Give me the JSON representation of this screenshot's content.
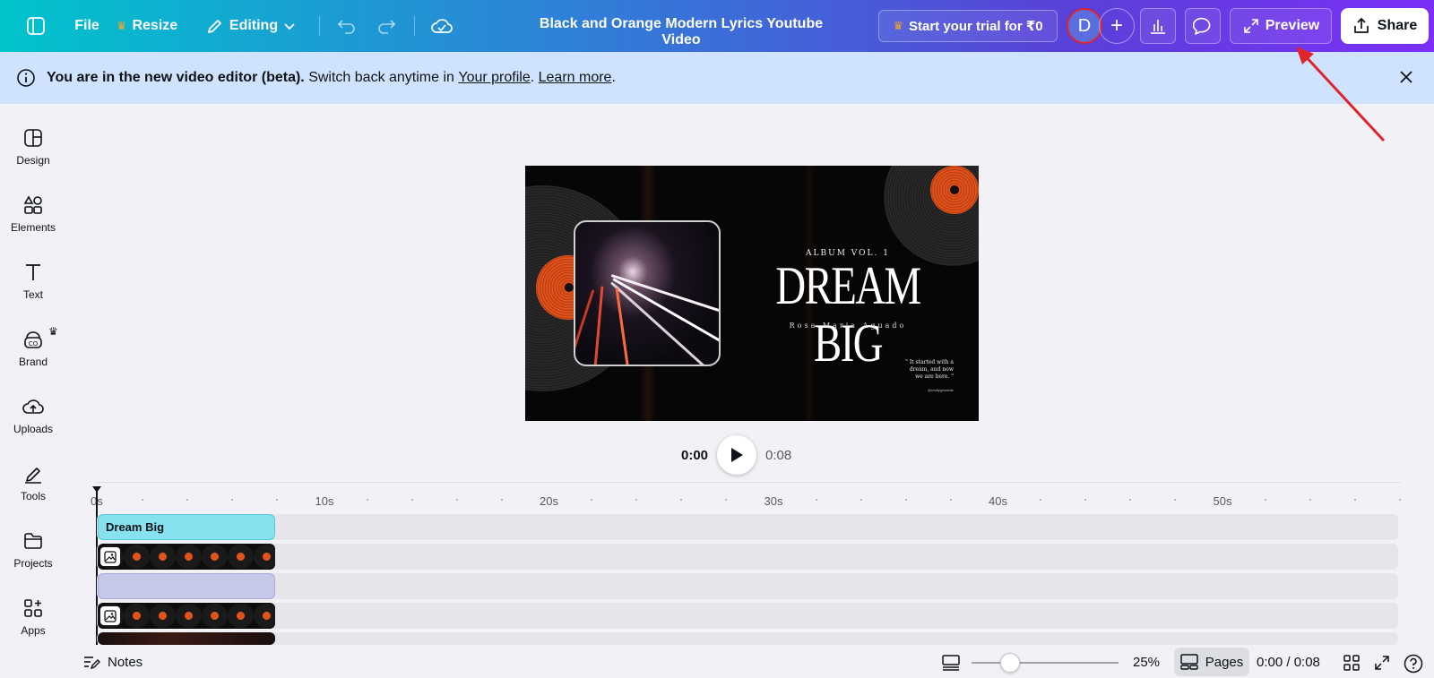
{
  "topbar": {
    "file_label": "File",
    "resize_label": "Resize",
    "editing_label": "Editing",
    "title": "Black and Orange Modern Lyrics Youtube Video",
    "trial_label": "Start your trial for ₹0",
    "avatar_initial": "D",
    "preview_label": "Preview",
    "share_label": "Share"
  },
  "banner": {
    "lead": "You are in the new video editor (beta).",
    "middle": " Switch back anytime in ",
    "profile_link": "Your profile",
    "dot1": ". ",
    "learn_link": "Learn more",
    "dot2": "."
  },
  "sidebar": {
    "items": [
      {
        "label": "Design",
        "icon": "design-icon"
      },
      {
        "label": "Elements",
        "icon": "elements-icon"
      },
      {
        "label": "Text",
        "icon": "text-icon"
      },
      {
        "label": "Brand",
        "icon": "brand-icon"
      },
      {
        "label": "Uploads",
        "icon": "uploads-icon"
      },
      {
        "label": "Tools",
        "icon": "tools-icon"
      },
      {
        "label": "Projects",
        "icon": "projects-icon"
      },
      {
        "label": "Apps",
        "icon": "apps-icon"
      }
    ]
  },
  "canvas": {
    "album": "ALBUM VOL. 1",
    "headline": "DREAM BIG",
    "artist": "Rosa Maria Aguado",
    "quote": "\" It started with a dream, and now we are here. \"",
    "handle": "@reallygreatsite"
  },
  "player": {
    "current": "0:00",
    "duration": "0:08"
  },
  "timeline": {
    "ticks": [
      "0s",
      "10s",
      "20s",
      "30s",
      "40s",
      "50s"
    ],
    "text_clip_label": "Dream Big"
  },
  "bottombar": {
    "notes_label": "Notes",
    "zoom": "25%",
    "pages_label": "Pages",
    "time_readout": "0:00 / 0:08"
  },
  "colors": {
    "accent_gradient_start": "#00c4cc",
    "accent_gradient_end": "#7b2ff7",
    "banner_bg": "#cfe3fe",
    "annotation_red": "#e0242b"
  }
}
